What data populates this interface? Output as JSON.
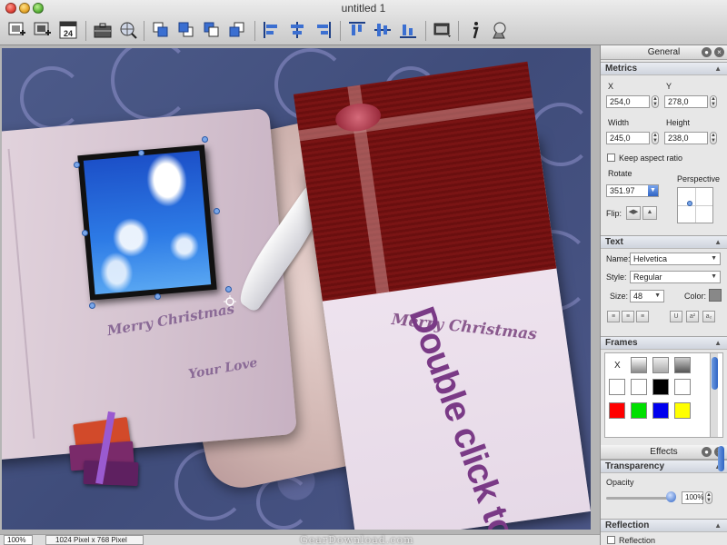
{
  "window": {
    "title": "untitled 1"
  },
  "toolbar": {
    "icons": [
      "insert-image-icon",
      "insert-shape-icon",
      "calendar-icon",
      "briefcase-icon",
      "globe-search-icon",
      "bring-to-front-icon",
      "bring-forward-icon",
      "send-backward-icon",
      "send-to-back-icon",
      "align-left-icon",
      "align-center-icon",
      "align-right-icon",
      "align-top-icon",
      "align-middle-icon",
      "align-bottom-icon",
      "arrange-icon",
      "inspector-icon",
      "media-browser-icon"
    ],
    "calendar_day": "24"
  },
  "canvas": {
    "card_script": "Merry Christmas",
    "card_big_text": "Double click to Edit",
    "book_script_1": "Merry Christmas",
    "book_script_2": "Your Love"
  },
  "status": {
    "zoom": "100%",
    "size": "1024 Pixel x 768 Pixel"
  },
  "watermark": "GearDownload.com",
  "inspector": {
    "title": "General",
    "metrics": {
      "heading": "Metrics",
      "x_label": "X",
      "x_value": "254,0",
      "y_label": "Y",
      "y_value": "278,0",
      "width_label": "Width",
      "width_value": "245,0",
      "height_label": "Height",
      "height_value": "238,0",
      "keep_aspect_label": "Keep aspect ratio",
      "rotate_label": "Rotate",
      "rotate_value": "351.97",
      "perspective_label": "Perspective",
      "flip_label": "Flip:"
    },
    "text": {
      "heading": "Text",
      "name_label": "Name:",
      "name_value": "Helvetica",
      "style_label": "Style:",
      "style_value": "Regular",
      "size_label": "Size:",
      "size_value": "48",
      "color_label": "Color:"
    },
    "frames": {
      "heading": "Frames",
      "none_label": "X",
      "colors": [
        "#ffffff",
        "#ffffff",
        "#000000",
        "#ffffff",
        "#ff0000",
        "#00e000",
        "#0000ee",
        "#ffff00"
      ]
    }
  },
  "effects": {
    "title": "Effects",
    "transparency": {
      "heading": "Transparency",
      "opacity_label": "Opacity",
      "opacity_value": "100%",
      "opacity_level": 1.0
    },
    "reflection": {
      "heading": "Reflection",
      "checkbox_label": "Reflection"
    }
  }
}
